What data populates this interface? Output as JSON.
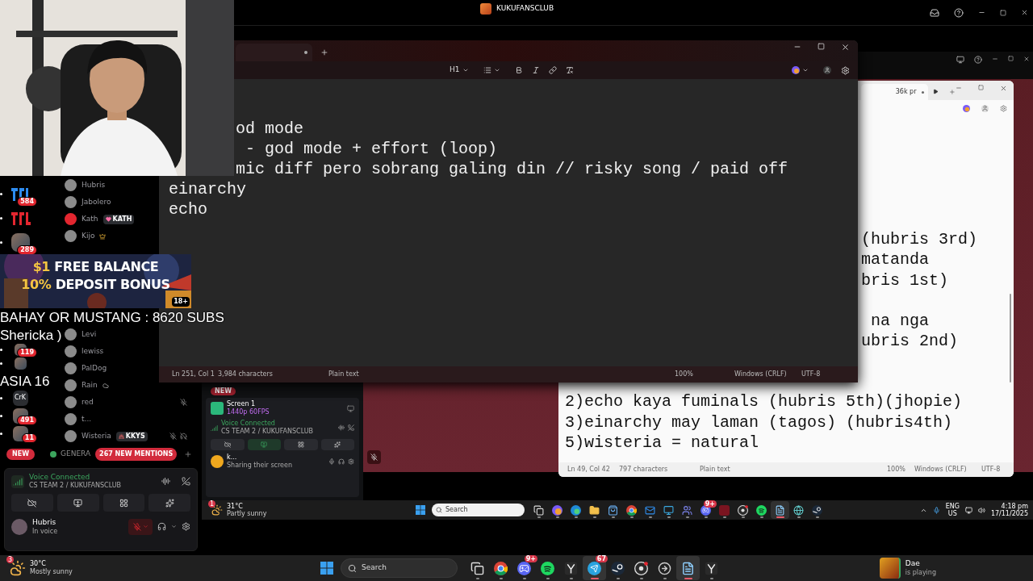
{
  "webcam": {
    "kind": "picture"
  },
  "discord": {
    "title": "KUKUFANSCLUB",
    "servers_top": [
      {
        "kind": "logo",
        "badge": "584"
      },
      {
        "kind": "logo"
      },
      {
        "kind": "avatar",
        "badge": "289"
      }
    ],
    "servers_bottom": [
      {
        "kind": "avatar",
        "badge": "119"
      },
      {
        "kind": "avatar"
      },
      {
        "kind": "text",
        "label": "CrK"
      },
      {
        "kind": "avatar",
        "badge": "491"
      },
      {
        "kind": "avatar",
        "badge": "11"
      }
    ],
    "members_top": [
      {
        "name": "Hubris",
        "kind": "plain"
      },
      {
        "name": "Jabolero",
        "kind": "plain"
      },
      {
        "name": "Kath",
        "kind": "tag",
        "tag": "KATH"
      },
      {
        "name": "Kijo",
        "kind": "crown"
      }
    ],
    "members_bottom": [
      {
        "name": "Levi",
        "kind": "plain",
        "muted": false,
        "deafened": false
      },
      {
        "name": "lewiss",
        "kind": "plain",
        "muted": false,
        "deafened": false
      },
      {
        "name": "PalDog",
        "kind": "plain",
        "muted": false,
        "deafened": false
      },
      {
        "name": "Rain",
        "kind": "cloud",
        "muted": false,
        "deafened": false
      },
      {
        "name": "red",
        "kind": "plain",
        "muted": true,
        "deafened": false
      },
      {
        "name": "t...",
        "kind": "plain",
        "muted": false,
        "deafened": false
      },
      {
        "name": "Wisteria",
        "kind": "tag",
        "tag": "KKYS",
        "muted": true,
        "deafened": true
      }
    ],
    "channel": {
      "new_label": "NEW",
      "name": "GENERA",
      "mentions": "267 NEW MENTIONS"
    },
    "voice": {
      "status": "Voice Connected",
      "channel": "CS TEAM 2 / KUKUFANSCLUB"
    },
    "user": {
      "name": "Hubris",
      "status": "In voice",
      "muted": true
    }
  },
  "shared_discord": {
    "new_label": "NEW",
    "stream": {
      "name": "Screen 1",
      "quality": "1440p 60FPS"
    },
    "voice": {
      "status": "Voice Connected",
      "channel": "CS TEAM 2 / KUKUFANSCLUB"
    },
    "sharing": true,
    "user": {
      "name": "k...",
      "status": "Sharing their screen"
    }
  },
  "notepad_dark": {
    "heading": "H1",
    "lines_beside_webcam": [
      "od mode",
      " - god mode + effort (loop)",
      "mic diff pero sobrang galing din // risky song / paid off"
    ],
    "lines": [
      "einarchy",
      "echo"
    ],
    "status": {
      "position": "Ln 251, Col 1",
      "count": "3,984 characters",
      "format": "Plain text",
      "zoom": "100%",
      "line_endings": "Windows (CRLF)",
      "encoding": "UTF-8"
    }
  },
  "notepad_light": {
    "tab": "36k pr",
    "upper_groups": [
      [
        "(hubris 3rd)",
        "matanda",
        "bris 1st)"
      ],
      [
        " na nga",
        "ubris 2nd)"
      ]
    ],
    "lower_lines": [
      "2)echo kaya fuminals (hubris 5th)(jhopie)",
      "3)einarchy may laman (tagos) (hubris4th)",
      "5)wisteria = natural"
    ],
    "status": {
      "position": "Ln 49, Col 42",
      "count": "797 characters",
      "format": "Plain text",
      "zoom": "100%",
      "line_endings": "Windows (CRLF)",
      "encoding": "UTF-8"
    }
  },
  "ad": {
    "line_1": {
      "highlight": "$1",
      "text": "FREE BALANCE"
    },
    "line_2": {
      "highlight": "10%",
      "text": "DEPOSIT BONUS"
    },
    "age": "18+"
  },
  "captions": [
    "BAHAY OR MUSTANG : 8620 SUBS",
    "Shericka )",
    "ASIA 16"
  ],
  "taskbar_inner": {
    "weather": {
      "alerts": "1",
      "temp": "31°C",
      "sky": "Partly sunny"
    },
    "search": "Search",
    "apps": [
      {
        "kind": "taskview",
        "active": false
      },
      {
        "kind": "copilot",
        "active": false
      },
      {
        "kind": "edge",
        "active": false
      },
      {
        "kind": "files",
        "active": false
      },
      {
        "kind": "store",
        "active": false
      },
      {
        "kind": "chrome",
        "active": false
      },
      {
        "kind": "mail",
        "active": false
      },
      {
        "kind": "monitor",
        "active": false
      },
      {
        "kind": "teams",
        "active": false
      },
      {
        "kind": "discord",
        "badge": "9+",
        "active": false
      },
      {
        "kind": "game",
        "active": false
      },
      {
        "kind": "obs",
        "active": false
      },
      {
        "kind": "spotify",
        "active": false
      },
      {
        "kind": "notepad",
        "active": true
      },
      {
        "kind": "globe",
        "active": false
      },
      {
        "kind": "steam",
        "active": false
      }
    ],
    "lang": "ENG",
    "region": "US",
    "time": "4:18 pm",
    "date": "17/11/2025"
  },
  "taskbar": {
    "weather": {
      "alerts": "3",
      "temp": "30°C",
      "sky": "Mostly sunny"
    },
    "search": "Search",
    "apps": [
      {
        "kind": "taskview",
        "active": false
      },
      {
        "kind": "chrome",
        "active": false
      },
      {
        "kind": "discord",
        "badge": "9+",
        "active": false
      },
      {
        "kind": "spotify",
        "active": false
      },
      {
        "kind": "epic",
        "active": false
      },
      {
        "kind": "telegram",
        "badge": "67",
        "active": true
      },
      {
        "kind": "steam",
        "active": false
      },
      {
        "kind": "obs",
        "active": false
      },
      {
        "kind": "arrow",
        "active": false
      },
      {
        "kind": "notepad",
        "active": true
      },
      {
        "kind": "epic",
        "active": false
      }
    ],
    "activity": {
      "name": "Dae",
      "status": "is playing"
    }
  }
}
